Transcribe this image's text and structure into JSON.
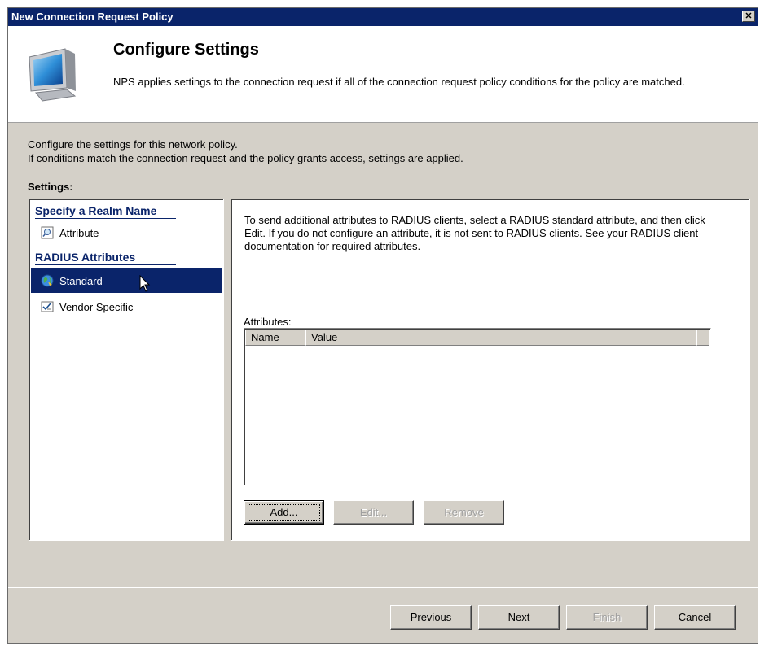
{
  "window": {
    "title": "New Connection Request Policy"
  },
  "header": {
    "title": "Configure Settings",
    "description": "NPS applies settings to the connection request if all of the connection request policy conditions for the policy are matched."
  },
  "intro": {
    "line1": "Configure the settings for this network policy.",
    "line2": "If conditions match the connection request and the policy grants access, settings are applied."
  },
  "settings_label": "Settings:",
  "nav": {
    "group1": "Specify a Realm Name",
    "item_attribute": "Attribute",
    "group2": "RADIUS Attributes",
    "item_standard": "Standard",
    "item_vendor": "Vendor Specific"
  },
  "main": {
    "help_text": "To send additional attributes to RADIUS clients, select a RADIUS standard attribute, and then click Edit. If you do not configure an attribute, it is not sent to RADIUS clients. See your RADIUS client documentation for required attributes.",
    "attributes_label": "Attributes:",
    "columns": [
      "Name",
      "Value"
    ],
    "buttons": {
      "add": "Add...",
      "edit": "Edit...",
      "remove": "Remove"
    }
  },
  "footer": {
    "previous": "Previous",
    "next": "Next",
    "finish": "Finish",
    "cancel": "Cancel"
  },
  "colors": {
    "titlebar": "#0a246a",
    "selection": "#0a246a",
    "dialog_bg": "#d4d0c8"
  }
}
